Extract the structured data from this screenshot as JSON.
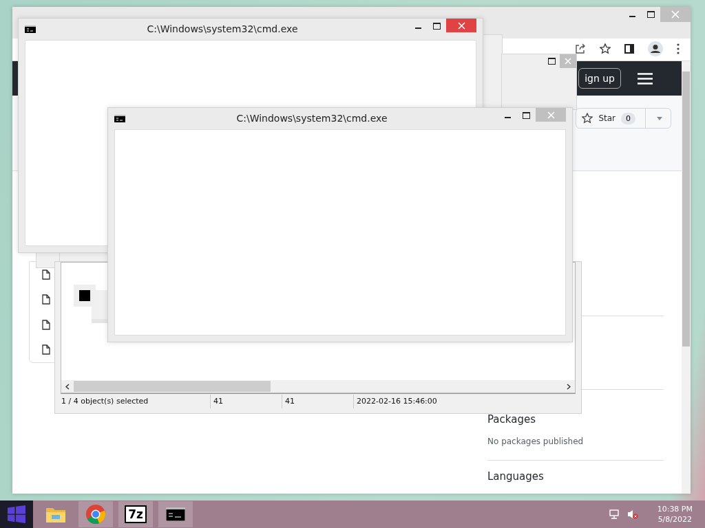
{
  "browser": {
    "sign_up_button": "ign up",
    "star_button": {
      "label": "Star",
      "count": "0"
    },
    "sidebar": [
      {
        "heading": "Packages",
        "text": "No packages published"
      },
      {
        "heading": "Languages"
      }
    ]
  },
  "archive_window": {
    "status_bar": [
      "1 / 4 object(s) selected",
      "41",
      "41",
      "2022-02-16 15:46:00"
    ]
  },
  "cmd_windows": [
    {
      "title": "C:\\Windows\\system32\\cmd.exe",
      "active": true
    },
    {
      "title": "C:\\Windows\\system32\\cmd.exe",
      "active": false
    }
  ],
  "taskbar": {
    "apps": [
      {
        "kind": "folder"
      },
      {
        "kind": "chrome"
      },
      {
        "kind": "archiver",
        "label": "7z"
      },
      {
        "kind": "cmd"
      }
    ],
    "clock": {
      "time": "10:38 PM",
      "date": "5/8/2022"
    }
  }
}
